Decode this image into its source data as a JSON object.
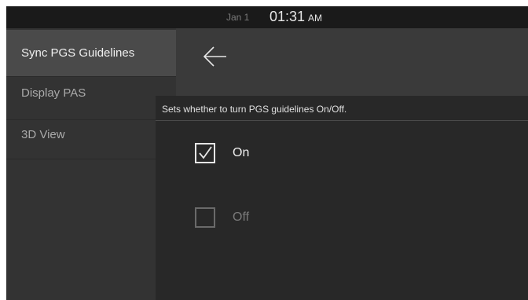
{
  "status": {
    "date": "Jan 1",
    "time": "01:31",
    "ampm": "AM"
  },
  "sidebar": {
    "items": [
      {
        "label": "Sync PGS Guidelines",
        "selected": true
      },
      {
        "label": "Display PAS",
        "selected": false
      },
      {
        "label": "3D View",
        "selected": false
      }
    ]
  },
  "header": {
    "back_icon": "arrow-left-icon"
  },
  "panel": {
    "description": "Sets whether to turn PGS guidelines On/Off.",
    "options": [
      {
        "label": "On",
        "checked": true
      },
      {
        "label": "Off",
        "checked": false
      }
    ]
  },
  "colors": {
    "background": "#2d2d2d",
    "sidebar_selected": "#4a4a4a",
    "text": "#f0f0f0",
    "disabled_text": "#7a7a7a"
  }
}
